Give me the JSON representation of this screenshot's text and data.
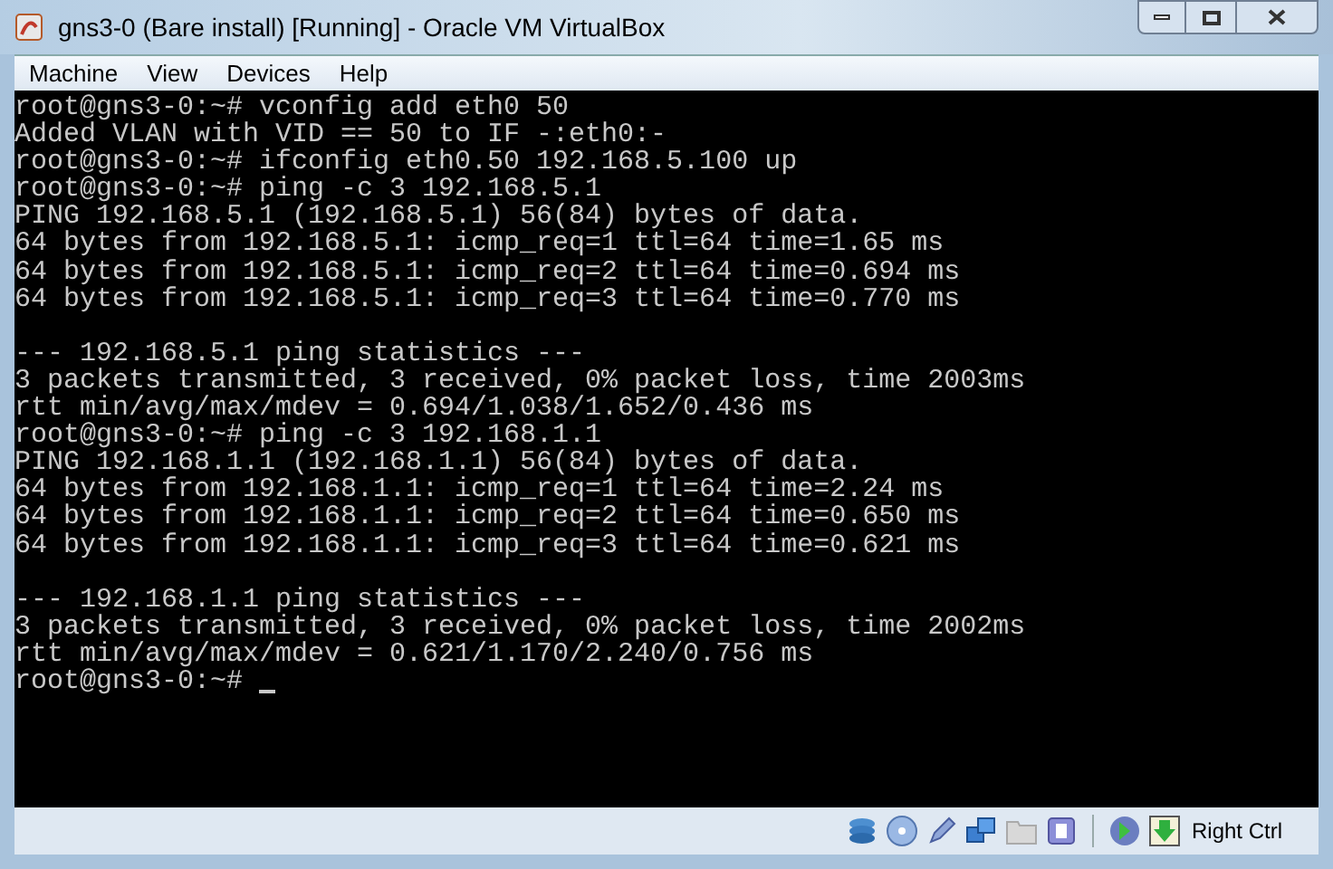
{
  "window": {
    "title": "gns3-0 (Bare install) [Running] - Oracle VM VirtualBox"
  },
  "menu": [
    "Machine",
    "View",
    "Devices",
    "Help"
  ],
  "terminal": {
    "blocks": [
      [
        "root@gns3-0:~# vconfig add eth0 50",
        "Added VLAN with VID == 50 to IF -:eth0:-",
        "root@gns3-0:~# ifconfig eth0.50 192.168.5.100 up",
        "root@gns3-0:~# ping -c 3 192.168.5.1",
        "PING 192.168.5.1 (192.168.5.1) 56(84) bytes of data.",
        "64 bytes from 192.168.5.1: icmp_req=1 ttl=64 time=1.65 ms",
        "64 bytes from 192.168.5.1: icmp_req=2 ttl=64 time=0.694 ms",
        "64 bytes from 192.168.5.1: icmp_req=3 ttl=64 time=0.770 ms"
      ],
      [
        "--- 192.168.5.1 ping statistics ---",
        "3 packets transmitted, 3 received, 0% packet loss, time 2003ms",
        "rtt min/avg/max/mdev = 0.694/1.038/1.652/0.436 ms",
        "root@gns3-0:~# ping -c 3 192.168.1.1",
        "PING 192.168.1.1 (192.168.1.1) 56(84) bytes of data.",
        "64 bytes from 192.168.1.1: icmp_req=1 ttl=64 time=2.24 ms",
        "64 bytes from 192.168.1.1: icmp_req=2 ttl=64 time=0.650 ms",
        "64 bytes from 192.168.1.1: icmp_req=3 ttl=64 time=0.621 ms"
      ],
      [
        "--- 192.168.1.1 ping statistics ---",
        "3 packets transmitted, 3 received, 0% packet loss, time 2002ms",
        "rtt min/avg/max/mdev = 0.621/1.170/2.240/0.756 ms",
        "root@gns3-0:~# "
      ]
    ]
  },
  "status_bar": {
    "host_key": "Right Ctrl"
  }
}
